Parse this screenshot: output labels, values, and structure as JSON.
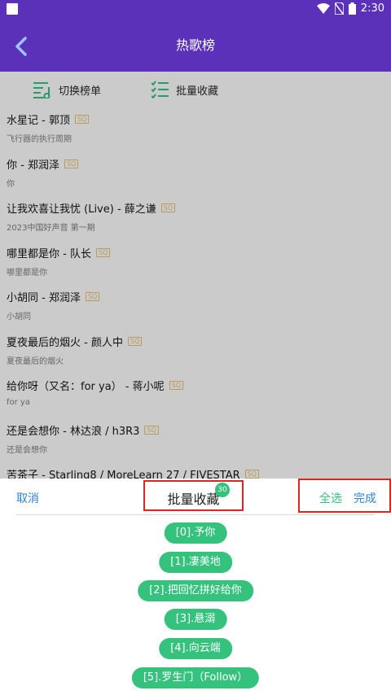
{
  "status_bar": {
    "time": "2:30"
  },
  "app_bar": {
    "title": "热歌榜"
  },
  "toolbar": {
    "switch_label": "切换榜单",
    "batch_label": "批量收藏"
  },
  "songs": [
    {
      "title": "水星记 - 郭顶",
      "badge": "SQ",
      "subtitle": "飞行器的执行周期"
    },
    {
      "title": "你 - 郑润泽",
      "badge": "SQ",
      "subtitle": "你"
    },
    {
      "title": "让我欢喜让我忧 (Live) - 薛之谦",
      "badge": "SQ",
      "subtitle": "2023中国好声音 第一期"
    },
    {
      "title": "哪里都是你 - 队长",
      "badge": "SQ",
      "subtitle": "哪里都是你"
    },
    {
      "title": "小胡同 - 郑润泽",
      "badge": "SQ",
      "subtitle": "小胡同"
    },
    {
      "title": "夏夜最后的烟火 - 颜人中",
      "badge": "SQ",
      "subtitle": "夏夜最后的烟火"
    },
    {
      "title": "给你呀（又名：for ya） - 蒋小呢",
      "badge": "SQ",
      "subtitle": "for ya"
    },
    {
      "title": "还是会想你 - 林达浪 / h3R3",
      "badge": "SQ",
      "subtitle": "还是会想你"
    },
    {
      "title": "苦茶子 - Starling8 / MoreLearn 27 / FIVESTAR",
      "badge": "SQ",
      "subtitle": ""
    }
  ],
  "sheet": {
    "cancel": "取消",
    "title": "批量收藏",
    "count": "30",
    "select_all": "全选",
    "done": "完成",
    "chips": [
      "[0].予你",
      "[1].凄美地",
      "[2].把回忆拼好给你",
      "[3].悬溺",
      "[4].向云端",
      "[5].罗生门（Follow）"
    ]
  },
  "colors": {
    "primary": "#5a31b8",
    "accent_green": "#35c27d",
    "link_blue": "#2b86d9",
    "highlight_red": "#e02424"
  }
}
